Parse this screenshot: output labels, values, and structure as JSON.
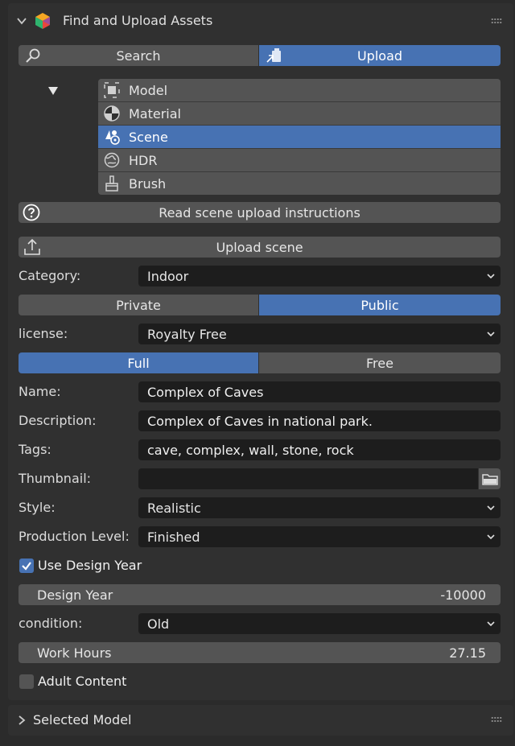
{
  "header": {
    "title": "Find and Upload Assets",
    "logo_icon": "blenderkit-logo-icon"
  },
  "mode_tabs": {
    "search_label": "Search",
    "upload_label": "Upload",
    "active": "Upload"
  },
  "asset_types": {
    "items": [
      {
        "label": "Model",
        "icon": "model-icon"
      },
      {
        "label": "Material",
        "icon": "material-icon"
      },
      {
        "label": "Scene",
        "icon": "scene-icon"
      },
      {
        "label": "HDR",
        "icon": "hdr-icon"
      },
      {
        "label": "Brush",
        "icon": "brush-icon"
      }
    ],
    "selected": "Scene"
  },
  "instructions_label": "Read scene upload instructions",
  "upload_label": "Upload scene",
  "form": {
    "category_label": "Category:",
    "category_value": "Indoor",
    "visibility": {
      "private_label": "Private",
      "public_label": "Public",
      "active": "Public"
    },
    "license_label": "license:",
    "license_value": "Royalty Free",
    "plan": {
      "full_label": "Full",
      "free_label": "Free",
      "active": "Full"
    },
    "name_label": "Name:",
    "name_value": "Complex of Caves",
    "description_label": "Description:",
    "description_value": "Complex of Caves in national park.",
    "tags_label": "Tags:",
    "tags_value": "cave, complex, wall, stone, rock",
    "thumbnail_label": "Thumbnail:",
    "thumbnail_value": "",
    "style_label": "Style:",
    "style_value": "Realistic",
    "production_label": "Production Level:",
    "production_value": "Finished",
    "use_design_year_label": "Use Design Year",
    "use_design_year_checked": true,
    "design_year_label": "Design Year",
    "design_year_value": "-10000",
    "condition_label": "condition:",
    "condition_value": "Old",
    "work_hours_label": "Work Hours",
    "work_hours_value": "27.15",
    "adult_label": "Adult Content",
    "adult_checked": false
  },
  "footer": {
    "title": "Selected Model"
  },
  "colors": {
    "accent": "#4772b3",
    "button": "#545454",
    "field": "#1d1d1d",
    "panel": "#303030"
  }
}
